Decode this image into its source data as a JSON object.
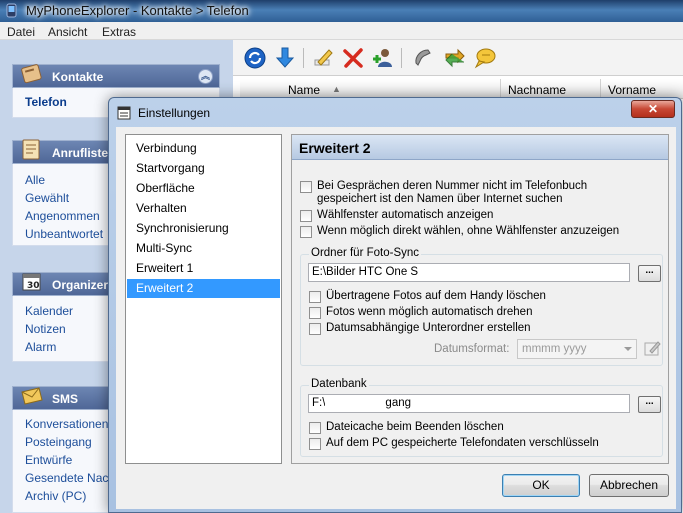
{
  "window": {
    "app_name": "MyPhoneExplorer",
    "separator": " - ",
    "breadcrumb": "Kontakte > Telefon"
  },
  "menu": [
    "Datei",
    "Ansicht",
    "Extras"
  ],
  "sidebar": {
    "groups": [
      {
        "title": "Kontakte",
        "icon": "contacts-book-icon",
        "items": [
          "Telefon"
        ]
      },
      {
        "title": "Anrufliste",
        "icon": "call-list-icon",
        "items": [
          "Alle",
          "Gewählt",
          "Angenommen",
          "Unbeantwortet"
        ]
      },
      {
        "title": "Organizer",
        "icon": "organizer-icon",
        "items": [
          "Kalender",
          "Notizen",
          "Alarm"
        ]
      },
      {
        "title": "SMS",
        "icon": "sms-envelope-icon",
        "items": [
          "Konversationen",
          "Posteingang",
          "Entwürfe",
          "Gesendete Nach",
          "Archiv (PC)"
        ]
      }
    ]
  },
  "toolbar": {
    "icons": [
      "refresh-icon",
      "download-icon",
      "edit-icon",
      "delete-icon",
      "add-contact-icon",
      "phone-call-icon",
      "sync-arrows-icon",
      "message-bubble-icon"
    ]
  },
  "grid": {
    "columns": [
      "Name",
      "Nachname",
      "Vorname"
    ]
  },
  "dialog": {
    "title": "Einstellungen",
    "close_label": "✕",
    "nav": [
      "Verbindung",
      "Startvorgang",
      "Oberfläche",
      "Verhalten",
      "Synchronisierung",
      "Multi-Sync",
      "Erweitert 1",
      "Erweitert 2"
    ],
    "selected_nav": "Erweitert 2",
    "panel_title": "Erweitert 2",
    "options": [
      {
        "label": "Bei Gesprächen deren Nummer nicht im Telefonbuch",
        "label2": "gespeichert ist den Namen über Internet suchen",
        "checked": false
      },
      {
        "label": "Wählfenster automatisch anzeigen",
        "checked": false
      },
      {
        "label": "Wenn möglich direkt wählen, ohne Wählfenster anzuzeigen",
        "checked": false
      }
    ],
    "photo_sync": {
      "legend": "Ordner für Foto-Sync",
      "path": "E:\\Bilder HTC One S",
      "browse_label": "...",
      "options": [
        {
          "label": "Übertragene Fotos auf dem Handy löschen",
          "checked": false
        },
        {
          "label": "Fotos wenn möglich automatisch drehen",
          "checked": false
        },
        {
          "label": "Datumsabhängige Unterordner erstellen",
          "checked": false
        }
      ],
      "date_format_label": "Datumsformat:",
      "date_format_value": "mmmm yyyy"
    },
    "database": {
      "legend": "Datenbank",
      "path_prefix": "F:\\",
      "path_suffix": "gang",
      "browse_label": "...",
      "options": [
        {
          "label": "Dateicache beim Beenden löschen",
          "checked": false
        },
        {
          "label": "Auf dem PC gespeicherte Telefondaten verschlüsseln",
          "checked": false
        }
      ]
    },
    "ok_label": "OK",
    "cancel_label": "Abbrechen"
  }
}
